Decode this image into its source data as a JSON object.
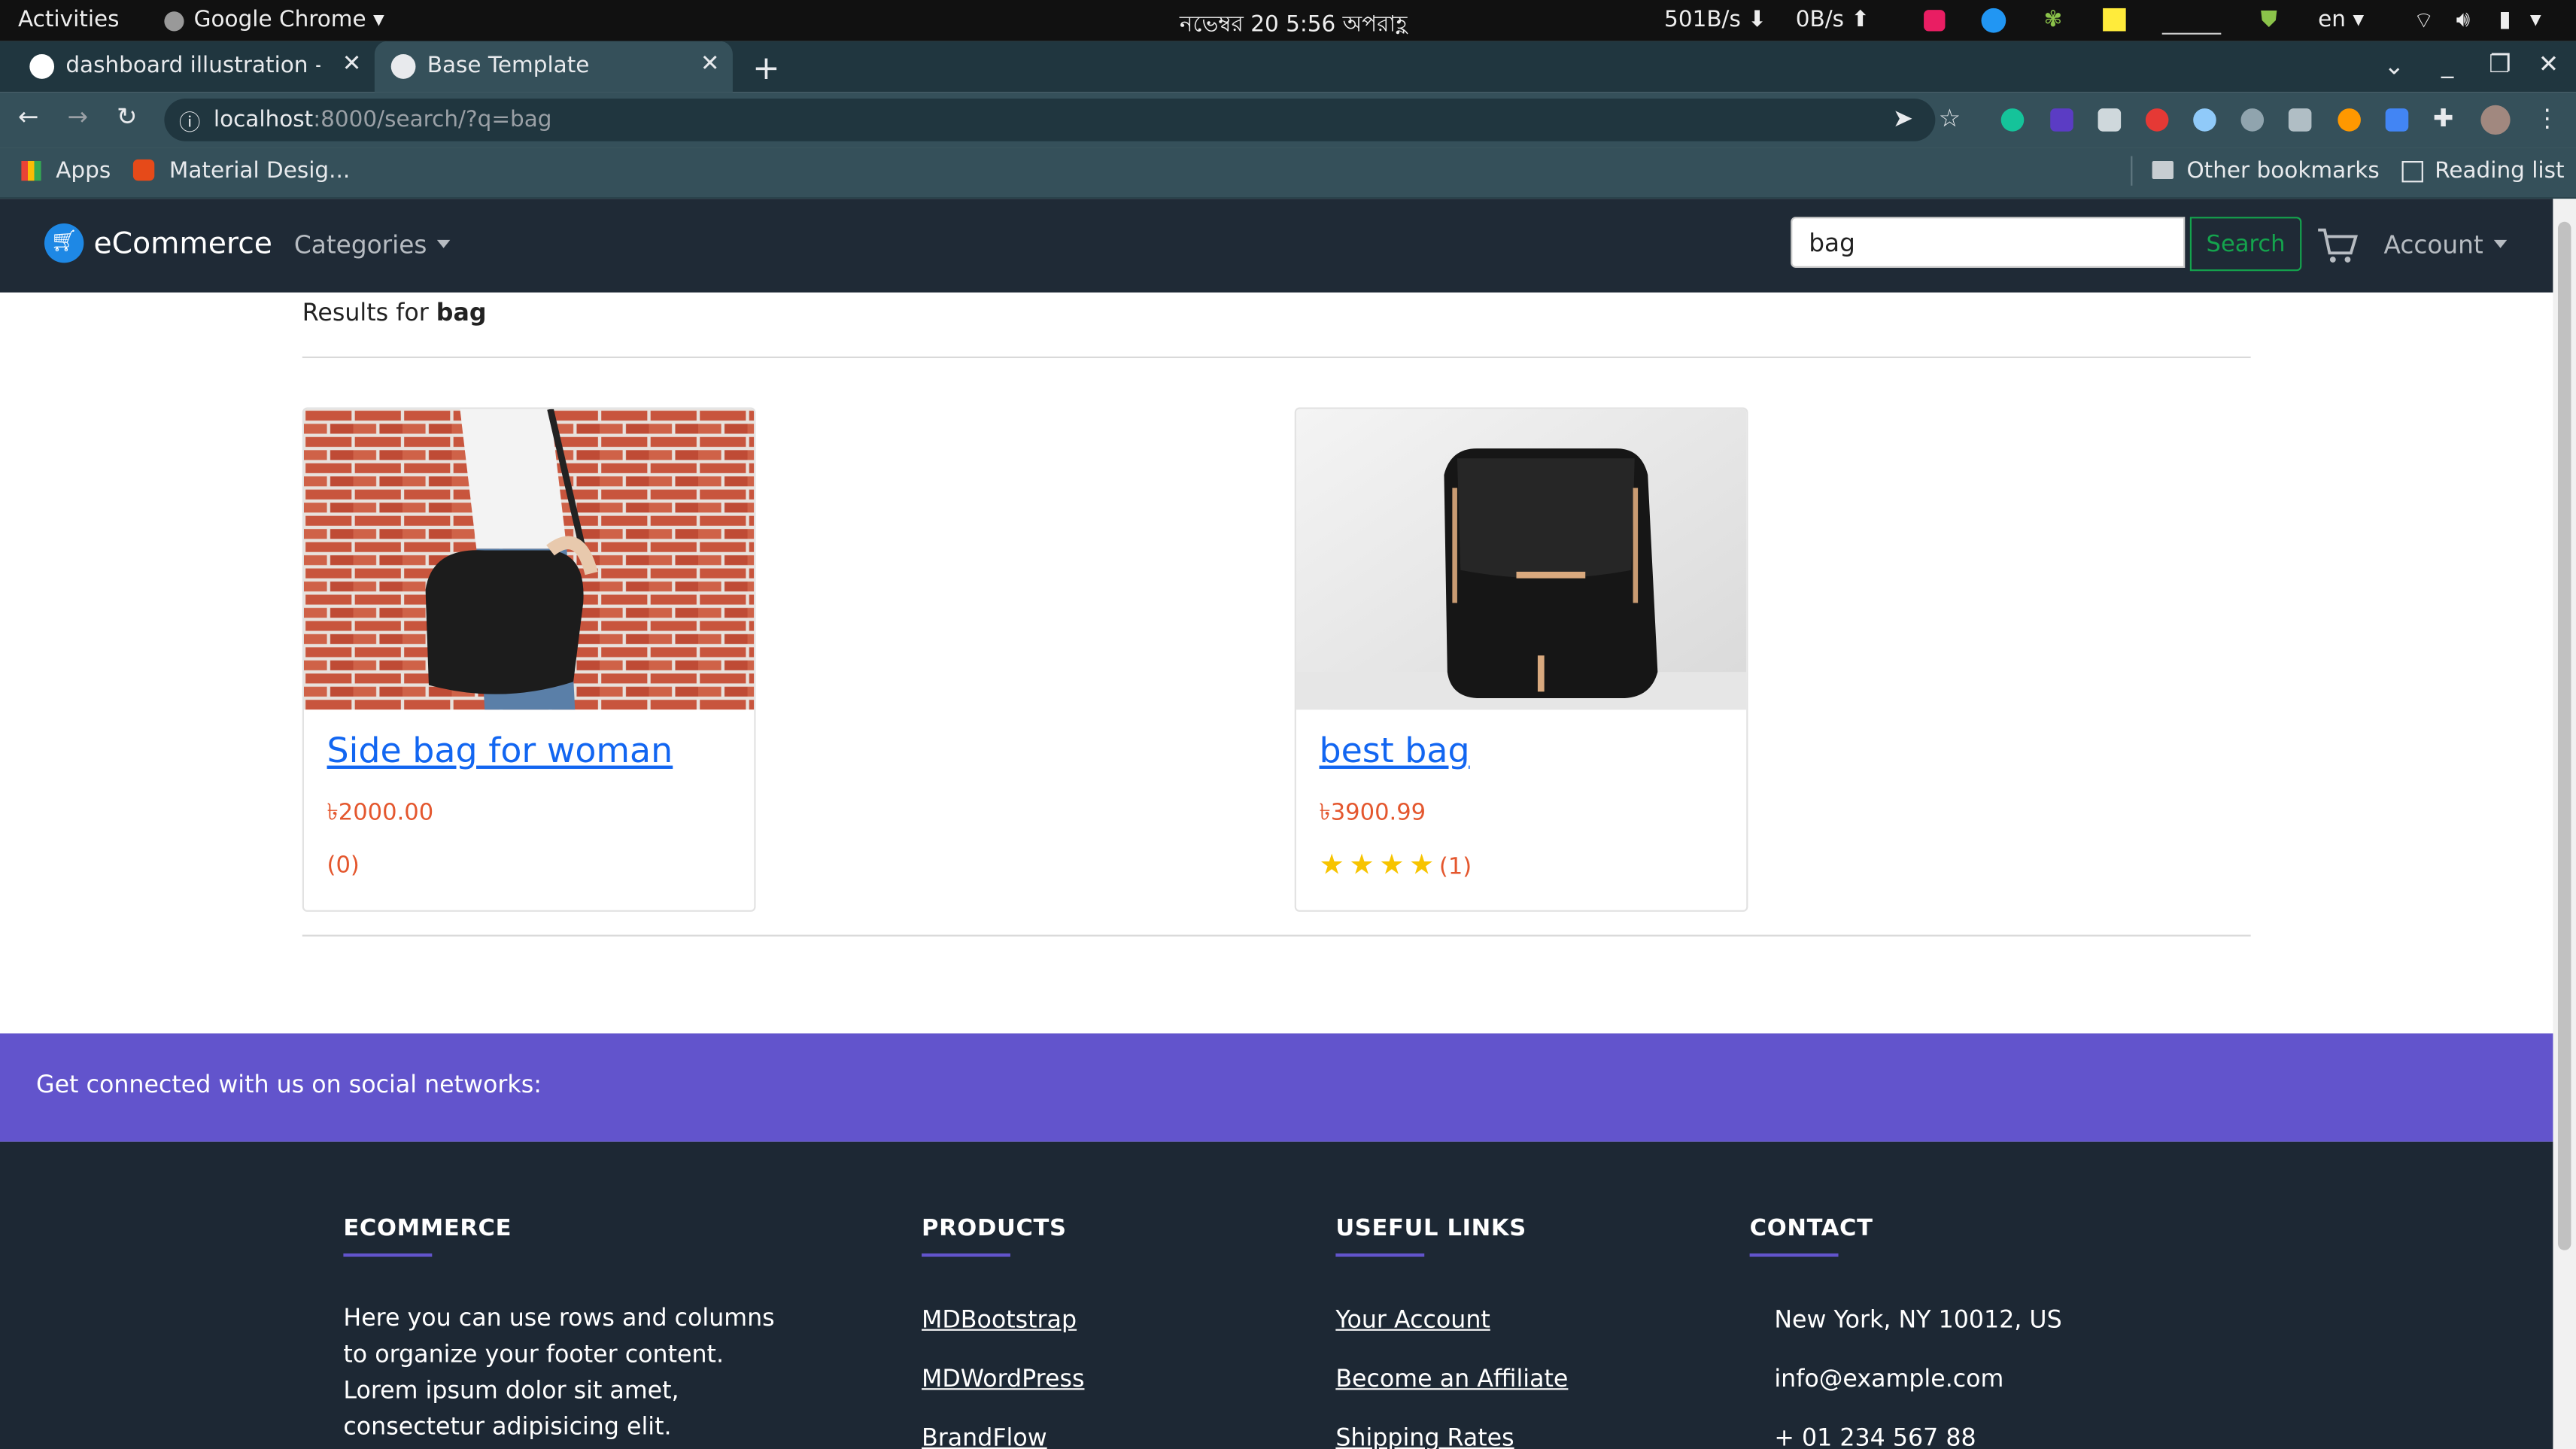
{
  "os_bar": {
    "activities": "Activities",
    "app": "Google Chrome",
    "clock": "নভেম্বর 20   5:56 অপরাহ্ণ",
    "net_down": "501B/s",
    "net_up": "0B/s",
    "lang": "en"
  },
  "browser": {
    "tabs": [
      {
        "title": "dashboard illustration - G"
      },
      {
        "title": "Base Template"
      }
    ],
    "url_host": "localhost",
    "url_path": ":8000/search/?q=bag",
    "bookmarks": {
      "apps": "Apps",
      "material": "Material Desig...",
      "other": "Other bookmarks",
      "reading": "Reading list"
    }
  },
  "navbar": {
    "brand": "eCommerce",
    "categories": "Categories",
    "search_value": "bag",
    "search_button": "Search",
    "account": "Account"
  },
  "results": {
    "prefix": "Results for ",
    "query": "bag",
    "products": [
      {
        "title": "Side bag for woman",
        "price": "৳2000.00",
        "rating_count": "(0)",
        "stars": 0
      },
      {
        "title": "best bag",
        "price": "৳3900.99",
        "rating_count": "(1)",
        "stars": 4
      }
    ]
  },
  "social": {
    "text": "Get connected with us on social networks:"
  },
  "footer": {
    "ecommerce": {
      "heading": "ECOMMERCE",
      "text": "Here you can use rows and columns to organize your footer content. Lorem ipsum dolor sit amet, consectetur adipisicing elit."
    },
    "products": {
      "heading": "PRODUCTS",
      "links": [
        "MDBootstrap",
        "MDWordPress",
        "BrandFlow"
      ]
    },
    "useful": {
      "heading": "USEFUL LINKS",
      "links": [
        "Your Account",
        "Become an Affiliate",
        "Shipping Rates"
      ]
    },
    "contact": {
      "heading": "CONTACT",
      "lines": [
        "New York, NY 10012, US",
        "info@example.com",
        "+ 01 234 567 88"
      ]
    }
  },
  "colors": {
    "navbar_bg": "#1f2a36",
    "footer_bg": "#1d2834",
    "social_bg": "#6254cc",
    "link": "#1266f1",
    "price": "#e4572e",
    "search_green": "#14a44d"
  }
}
